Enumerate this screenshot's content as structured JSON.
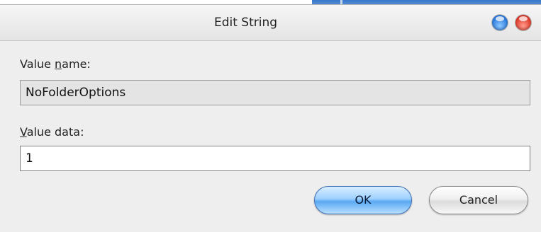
{
  "window": {
    "title": "Edit String"
  },
  "titlebar_buttons": {
    "help_icon": "blue-orb-icon",
    "close_icon": "red-orb-icon",
    "help_color": "#2f7fe0",
    "close_color": "#e2402f"
  },
  "value_name": {
    "label_underlined": "n",
    "label_prefix": "Value ",
    "label_suffix": "ame:",
    "value": "NoFolderOptions"
  },
  "value_data": {
    "label_underlined": "V",
    "label_suffix": "alue data:",
    "value": "1"
  },
  "buttons": {
    "ok_label": "OK",
    "cancel_label": "Cancel"
  },
  "colors": {
    "dialog_background": "#eeeeee",
    "ok_accent": "#5aa8f2"
  }
}
